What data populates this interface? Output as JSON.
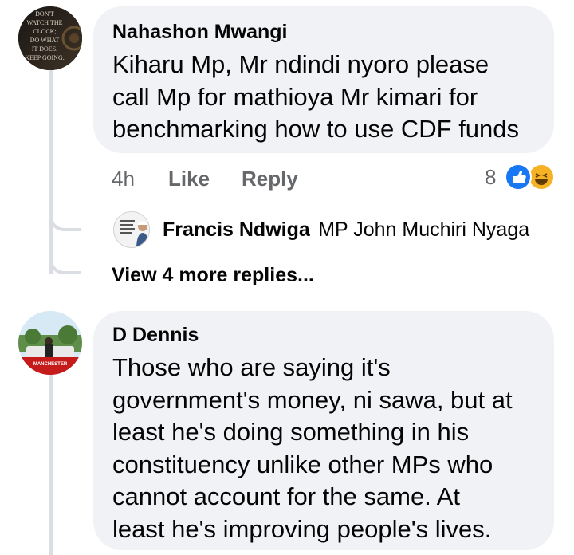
{
  "comment1": {
    "author": "Nahashon Mwangi",
    "avatar_text": [
      "DON'T",
      "WATCH THE",
      "CLOCK;",
      "DO WHAT",
      "IT DOES.",
      "KEEP GOING."
    ],
    "text_lines": [
      "Kiharu Mp, Mr ndindi nyoro please",
      "call Mp for mathioya Mr kimari for",
      "benchmarking how to use CDF funds"
    ],
    "time": "4h",
    "like_label": "Like",
    "reply_label": "Reply",
    "reaction_count": "8",
    "reactions": [
      "like-icon",
      "haha-icon"
    ]
  },
  "reply1": {
    "author": "Francis Ndwiga",
    "text": "MP John Muchiri Nyaga"
  },
  "view_more": "View 4 more replies...",
  "comment2": {
    "author": "D Dennis",
    "avatar_badge": "MANCHESTER",
    "text_lines": [
      "Those who are saying it's",
      "government's money, ni sawa, but at",
      "least he's doing something in his",
      "constituency unlike other MPs who",
      "cannot account for the same. At",
      "least he's improving people's lives."
    ]
  },
  "colors": {
    "bubble": "#f0f2f5",
    "secondary_text": "#65676b",
    "like_blue": "#1877f2",
    "haha_yellow": "#f7b125",
    "thread_line": "#dadde1"
  }
}
